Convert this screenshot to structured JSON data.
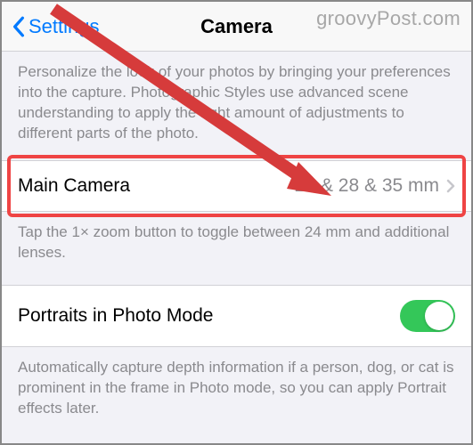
{
  "watermark": "groovyPost.com",
  "header": {
    "back_label": "Settings",
    "title": "Camera"
  },
  "section1": {
    "description": "Personalize the look of your photos by bringing your preferences into the capture. Photographic Styles use advanced scene understanding to apply the right amount of adjustments to different parts of the photo."
  },
  "main_camera": {
    "label": "Main Camera",
    "value": "24 & 28 & 35 mm",
    "footer": "Tap the 1× zoom button to toggle between 24 mm and additional lenses."
  },
  "portraits": {
    "label": "Portraits in Photo Mode",
    "toggle_on": true,
    "footer": "Automatically capture depth information if a person, dog, or cat is prominent in the frame in Photo mode, so you can apply Portrait effects later."
  }
}
